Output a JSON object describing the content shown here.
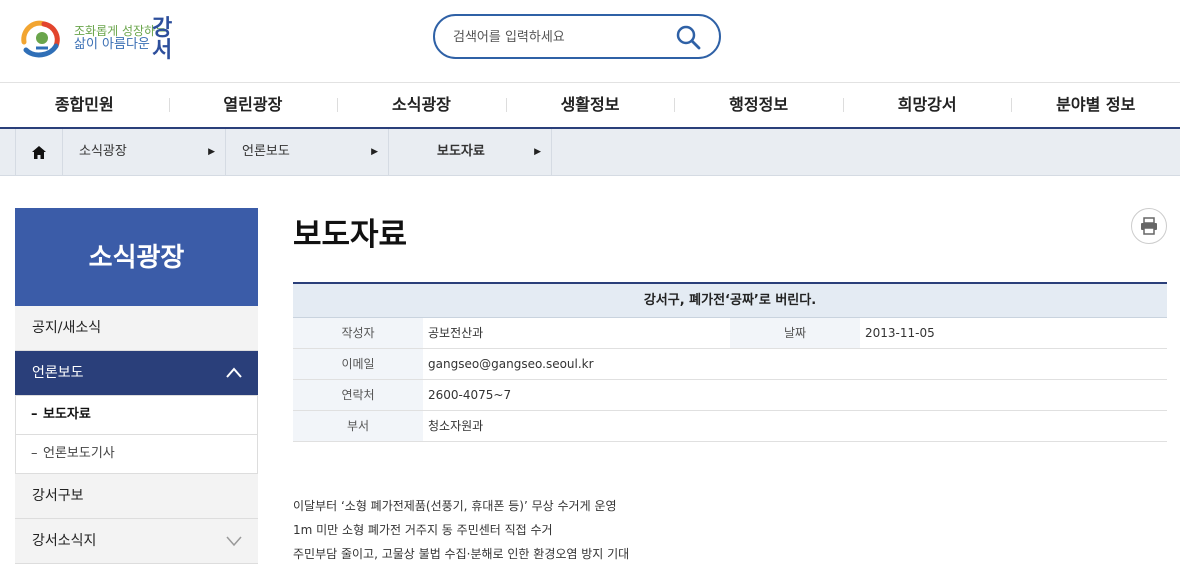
{
  "header": {
    "logo_line1": "조화롭게 성장하는",
    "logo_line2": "삶이 아름다운",
    "logo_big": "강서",
    "search_placeholder": "검색어를 입력하세요"
  },
  "gnb": [
    "종합민원",
    "열린광장",
    "소식광장",
    "생활정보",
    "행정정보",
    "희망강서",
    "분야별 정보"
  ],
  "breadcrumb": {
    "level1": "소식광장",
    "level2": "언론보도",
    "level3": "보도자료"
  },
  "sidebar": {
    "title": "소식광장",
    "items": [
      {
        "label": "공지/새소식"
      },
      {
        "label": "언론보도"
      },
      {
        "label": "보도자료"
      },
      {
        "label": "언론보도기사"
      },
      {
        "label": "강서구보"
      },
      {
        "label": "강서소식지"
      }
    ]
  },
  "page_title": "보도자료",
  "article": {
    "subject": "강서구, 폐가전‘공짜’로 버린다.",
    "author_label": "작성자",
    "author": "공보전산과",
    "date_label": "날짜",
    "date": "2013-11-05",
    "email_label": "이메일",
    "email": "gangseo@gangseo.seoul.kr",
    "phone_label": "연락처",
    "phone": "2600-4075~7",
    "dept_label": "부서",
    "dept": "청소자원과",
    "body": [
      "이달부터 ‘소형 폐가전제품(선풍기, 휴대폰 등)’ 무상 수거게 운영",
      "1m 미만 소형 폐가전 거주지 동 주민센터 직접 수거",
      "주민부담 줄이고, 고물상 불법 수집·분해로 인한 환경오염 방지 기대"
    ]
  },
  "colors": {
    "primary": "#2a3f7a",
    "side_title": "#3b5ca8",
    "search_border": "#2f61a6"
  },
  "icons": {
    "search": "search-icon",
    "home": "home-icon",
    "print": "print-icon"
  }
}
